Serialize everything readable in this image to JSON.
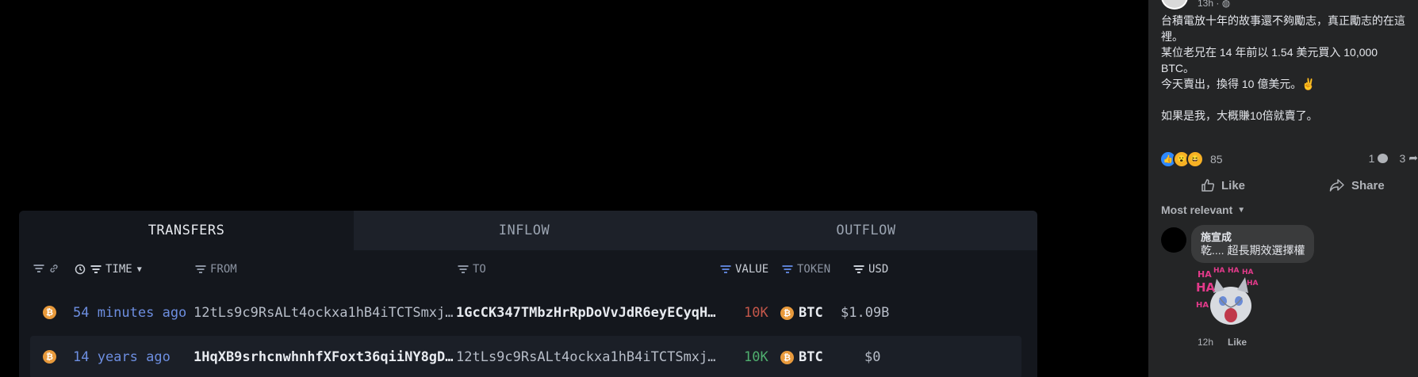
{
  "transfers_panel": {
    "tabs": [
      "TRANSFERS",
      "INFLOW",
      "OUTFLOW"
    ],
    "headers": {
      "time": "TIME",
      "from": "FROM",
      "to": "TO",
      "value": "VALUE",
      "token": "TOKEN",
      "usd": "USD"
    },
    "rows": [
      {
        "time": "54 minutes ago",
        "from": "12tLs9c9RsALt4ockxa1hB4iTCTSmxj…",
        "to": "1GcCK347TMbzHrRpDoVvJdR6eyECyqH…",
        "value": "10K",
        "value_color": "#c4574a",
        "token": "BTC",
        "usd": "$1.09B"
      },
      {
        "time": "14 years ago",
        "from": "1HqXB9srhcnwhnhfXFoxt36qiiNY8gD…",
        "to": "12tLs9c9RsALt4ockxa1hB4iTCTSmxj…",
        "value": "10K",
        "value_color": "#4fae6e",
        "token": "BTC",
        "usd": "$0"
      }
    ],
    "icons": [
      "link-icon",
      "clock-icon",
      "filter-icon",
      "bitcoin-icon"
    ]
  },
  "facebook_post": {
    "timestamp": "13h",
    "lines": [
      "台積電放十年的故事還不夠勵志，真正勵志的在這裡。",
      "某位老兄在 14 年前以 1.54 美元買入 10,000 BTC。",
      "今天賣出，換得 10 億美元。✌️",
      "如果是我，大概賺10倍就賣了。"
    ],
    "reaction_count": "85",
    "comment_count": "1",
    "share_count": "3",
    "like_label": "Like",
    "share_label": "Share",
    "sort_label": "Most relevant",
    "comment": {
      "name": "施宣成",
      "text": "乾.... 超長期效選擇權",
      "time": "12h",
      "like_label": "Like"
    }
  }
}
